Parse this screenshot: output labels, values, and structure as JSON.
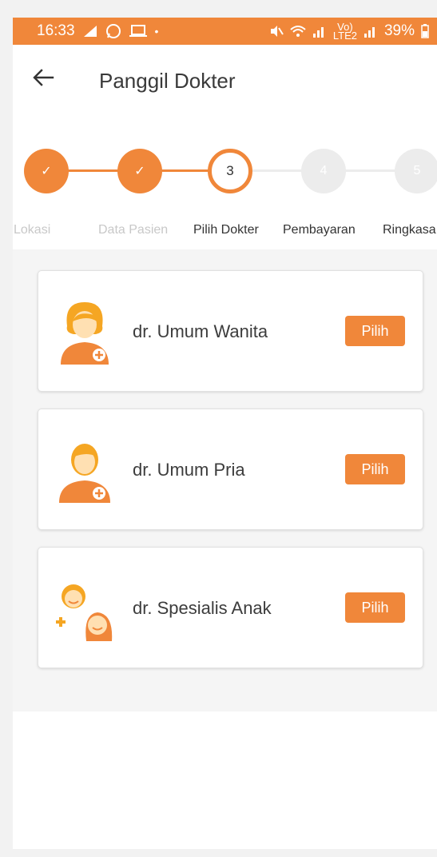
{
  "status_bar": {
    "time": "16:33",
    "battery": "39%",
    "icons": [
      "whatsapp-icon",
      "laptop-icon",
      "mute-icon",
      "wifi-icon",
      "signal-icon",
      "battery-icon"
    ],
    "volte": "Vo)",
    "lte": "LTE2"
  },
  "app_bar": {
    "title": "Panggil Dokter",
    "back_icon": "arrow-left-icon"
  },
  "stepper": {
    "steps": [
      {
        "label": "Lokasi",
        "marker": "✓",
        "state": "done"
      },
      {
        "label": "Data Pasien",
        "marker": "✓",
        "state": "done"
      },
      {
        "label": "Pilih Dokter",
        "marker": "3",
        "state": "active"
      },
      {
        "label": "Pembayaran",
        "marker": "4",
        "state": "todo"
      },
      {
        "label": "Ringkasa",
        "marker": "5",
        "state": "todo"
      }
    ]
  },
  "doctors": [
    {
      "name": "dr. Umum Wanita",
      "button": "Pilih",
      "icon": "female-doctor-icon"
    },
    {
      "name": "dr. Umum Pria",
      "button": "Pilih",
      "icon": "male-doctor-icon"
    },
    {
      "name": "dr. Spesialis Anak",
      "button": "Pilih",
      "icon": "pediatrician-icon"
    }
  ],
  "colors": {
    "accent": "#F0873A",
    "inactive_step": "#ececec"
  }
}
